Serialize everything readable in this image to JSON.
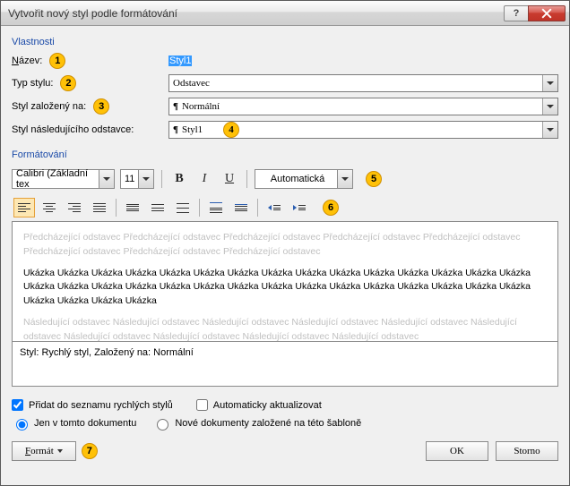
{
  "titlebar": {
    "title": "Vytvořit nový styl podle formátování"
  },
  "sections": {
    "properties": "Vlastnosti",
    "formatting": "Formátování"
  },
  "labels": {
    "name": "Název:",
    "styleType": "Typ stylu:",
    "basedOn": "Styl založený na:",
    "following": "Styl následujícího odstavce:"
  },
  "fields": {
    "name": "Styl1",
    "styleType": "Odstavec",
    "basedOn": "Normální",
    "following": "Styl1"
  },
  "markers": {
    "m1": "1",
    "m2": "2",
    "m3": "3",
    "m4": "4",
    "m5": "5",
    "m6": "6",
    "m7": "7"
  },
  "toolbar": {
    "font": "Calibri (Základní tex",
    "size": "11",
    "color": "Automatická"
  },
  "preview": {
    "prevPara": "Předcházející odstavec Předcházející odstavec Předcházející odstavec Předcházející odstavec Předcházející odstavec Předcházející odstavec Předcházející odstavec Předcházející odstavec",
    "sample": "Ukázka Ukázka Ukázka Ukázka Ukázka Ukázka Ukázka Ukázka Ukázka Ukázka Ukázka Ukázka Ukázka Ukázka Ukázka Ukázka Ukázka Ukázka Ukázka Ukázka Ukázka Ukázka Ukázka Ukázka Ukázka Ukázka Ukázka Ukázka Ukázka Ukázka Ukázka Ukázka Ukázka Ukázka",
    "nextPara": "Následující odstavec Následující odstavec Následující odstavec Následující odstavec Následující odstavec Následující odstavec Následující odstavec Následující odstavec Následující odstavec Následující odstavec"
  },
  "description": "Styl: Rychlý styl, Založený na: Normální",
  "checks": {
    "quickList": "Přidat do seznamu rychlých stylů",
    "autoUpdate": "Automaticky aktualizovat"
  },
  "radios": {
    "thisDoc": "Jen v tomto dokumentu",
    "template": "Nové dokumenty založené na této šabloně"
  },
  "buttons": {
    "format": "Formát",
    "ok": "OK",
    "cancel": "Storno"
  }
}
